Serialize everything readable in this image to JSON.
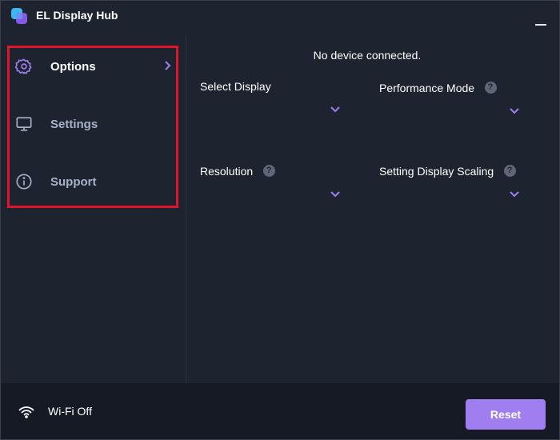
{
  "app": {
    "title": "EL Display Hub",
    "logo_icon": "el-display-hub-logo",
    "minimize_icon": "minimize-icon"
  },
  "sidebar": {
    "items": [
      {
        "label": "Options",
        "icon": "gear-icon",
        "active": true,
        "has_chevron": true
      },
      {
        "label": "Settings",
        "icon": "monitor-icon",
        "active": false
      },
      {
        "label": "Support",
        "icon": "info-icon",
        "active": false
      }
    ],
    "highlight_color": "#e0152a"
  },
  "main": {
    "status": "No device connected.",
    "fields": {
      "select_display": {
        "label": "Select Display",
        "has_help": false
      },
      "performance_mode": {
        "label": "Performance Mode",
        "has_help": true
      },
      "resolution": {
        "label": "Resolution",
        "has_help": true
      },
      "display_scaling": {
        "label": "Setting Display Scaling",
        "has_help": true
      }
    },
    "help_glyph": "?"
  },
  "footer": {
    "wifi_label": "Wi-Fi Off",
    "wifi_icon": "wifi-icon",
    "reset_label": "Reset"
  },
  "colors": {
    "background": "#1e2330",
    "footer_background": "#151a25",
    "accent": "#a07ef0",
    "inactive_text": "#a7b1c9"
  }
}
